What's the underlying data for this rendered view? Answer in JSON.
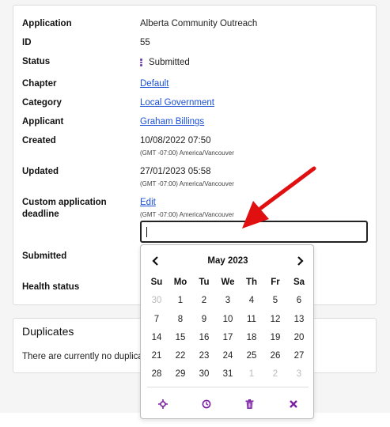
{
  "details": {
    "rows": [
      {
        "label": "Application",
        "value": "Alberta Community Outreach"
      },
      {
        "label": "ID",
        "value": "55"
      },
      {
        "label": "Status",
        "value": "Submitted"
      },
      {
        "label": "Chapter",
        "value": "Default"
      },
      {
        "label": "Category",
        "value": "Local Government"
      },
      {
        "label": "Applicant",
        "value": "Graham Billings"
      },
      {
        "label": "Created",
        "value": "10/08/2022 07:50",
        "tz": "(GMT -07:00) America/Vancouver"
      },
      {
        "label": "Updated",
        "value": "27/01/2023 05:58",
        "tz": "(GMT -07:00) America/Vancouver"
      },
      {
        "label": "Custom application deadline",
        "value": "Edit",
        "tz": "(GMT -07:00) America/Vancouver"
      },
      {
        "label": "Submitted",
        "value": ""
      },
      {
        "label": "Health status",
        "value": ""
      }
    ],
    "deadline_input_value": ""
  },
  "duplicates": {
    "title": "Duplicates",
    "text": "There are currently no duplicates"
  },
  "calendar": {
    "month_label": "May 2023",
    "prev_icon": "chevron-left-icon",
    "next_icon": "chevron-right-icon",
    "weekdays": [
      "Su",
      "Mo",
      "Tu",
      "We",
      "Th",
      "Fr",
      "Sa"
    ],
    "weeks": [
      [
        "30",
        "1",
        "2",
        "3",
        "4",
        "5",
        "6"
      ],
      [
        "7",
        "8",
        "9",
        "10",
        "11",
        "12",
        "13"
      ],
      [
        "14",
        "15",
        "16",
        "17",
        "18",
        "19",
        "20"
      ],
      [
        "21",
        "22",
        "23",
        "24",
        "25",
        "26",
        "27"
      ],
      [
        "28",
        "29",
        "30",
        "31",
        "1",
        "2",
        "3"
      ]
    ],
    "muted": [
      [
        0,
        0
      ],
      [
        4,
        4
      ],
      [
        4,
        5
      ],
      [
        4,
        6
      ]
    ],
    "tools": [
      "crosshair-icon",
      "clock-icon",
      "trash-icon",
      "close-icon"
    ],
    "tool_color": "#7b1fa2"
  },
  "colors": {
    "link": "#1a4fd6",
    "arrow": "#e01010",
    "status_dots": "#6a3fb5"
  }
}
